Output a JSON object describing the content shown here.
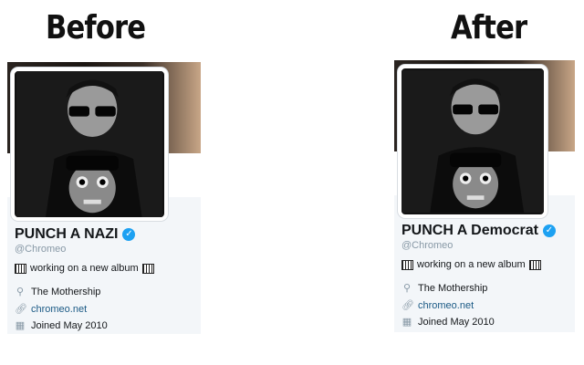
{
  "headings": {
    "before": "Before",
    "after": "After"
  },
  "before": {
    "name": "PUNCH A NAZI",
    "handle": "@Chromeo",
    "bio": "working on a new album",
    "location": "The Mothership",
    "website": "chromeo.net",
    "joined": "Joined May 2010"
  },
  "after": {
    "name": "PUNCH A Democrat",
    "handle": "@Chromeo",
    "bio": "working on a new album",
    "location": "The Mothership",
    "website": "chromeo.net",
    "joined": "Joined May 2010"
  },
  "icons": {
    "verified": "verified-badge-icon",
    "piano": "piano-keys-icon",
    "location": "location-pin-icon",
    "link": "link-icon",
    "calendar": "calendar-icon"
  },
  "colors": {
    "verified": "#1da1f2",
    "link": "#1b5a85",
    "muted": "#8899a6"
  }
}
